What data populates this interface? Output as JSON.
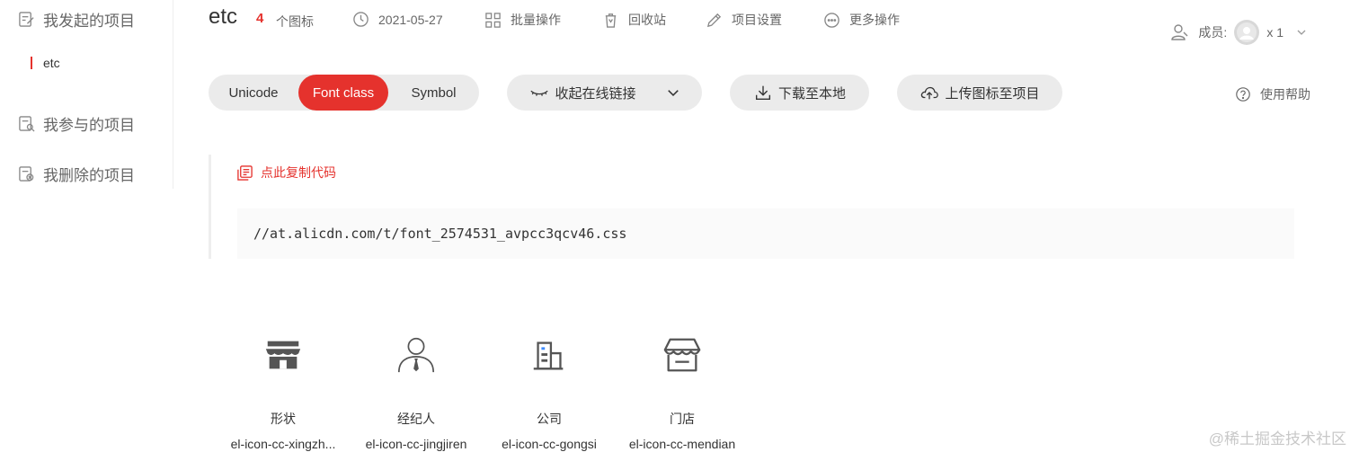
{
  "sidebar": {
    "my_projects": "我发起的项目",
    "sub_project": "etc",
    "joined_projects": "我参与的项目",
    "deleted_projects": "我删除的项目"
  },
  "header": {
    "project_name": "etc",
    "icon_count": "4",
    "icon_count_label": "个图标",
    "date": "2021-05-27",
    "batch_ops": "批量操作",
    "recycle_bin": "回收站",
    "project_settings": "项目设置",
    "more_ops": "更多操作",
    "members_label": "成员:",
    "members_count": "x 1"
  },
  "toolbar": {
    "tabs": [
      "Unicode",
      "Font class",
      "Symbol"
    ],
    "active_tab": "Font class",
    "collapse_link": "收起在线链接",
    "download": "下载至本地",
    "upload": "上传图标至项目",
    "help": "使用帮助"
  },
  "code": {
    "copy_label": "点此复制代码",
    "url": "//at.alicdn.com/t/font_2574531_avpcc3qcv46.css"
  },
  "icons": [
    {
      "name": "形状",
      "class": "el-icon-cc-xingzh...",
      "icon": "store-icon"
    },
    {
      "name": "经纪人",
      "class": "el-icon-cc-jingjiren",
      "icon": "agent-icon"
    },
    {
      "name": "公司",
      "class": "el-icon-cc-gongsi",
      "icon": "company-icon"
    },
    {
      "name": "门店",
      "class": "el-icon-cc-mendian",
      "icon": "shop-icon"
    }
  ],
  "watermark": "@稀土掘金技术社区",
  "colors": {
    "accent": "#e5322d",
    "pill_bg": "#ebebeb"
  }
}
